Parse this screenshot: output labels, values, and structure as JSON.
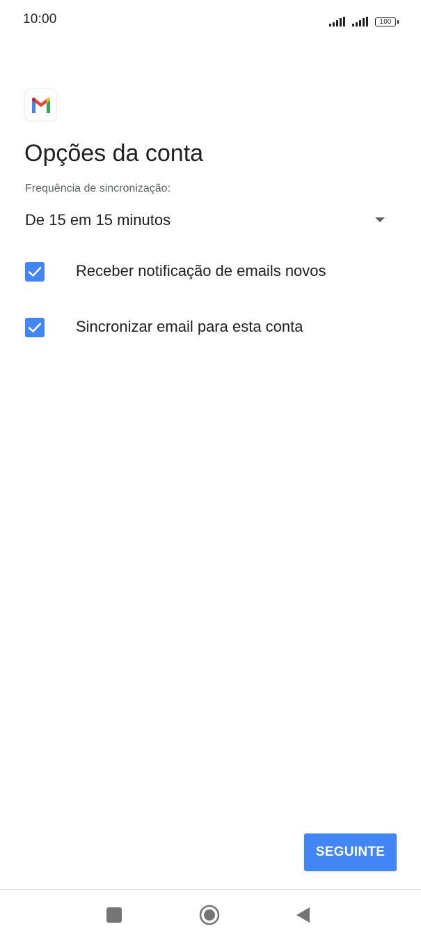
{
  "status_bar": {
    "time": "10:00",
    "battery": "100"
  },
  "page": {
    "title": "Opções da conta",
    "sync_label": "Frequência de sincronização:",
    "sync_value": "De 15 em 15 minutos",
    "options": [
      {
        "label": "Receber notificação de emails novos",
        "checked": true
      },
      {
        "label": "Sincronizar email para esta conta",
        "checked": true
      }
    ],
    "next_button": "SEGUINTE"
  },
  "colors": {
    "accent": "#4285f4",
    "text_primary": "#202124",
    "text_secondary": "#5f6368"
  },
  "icons": {
    "logo": "gmail-icon",
    "dropdown": "dropdown-arrow-icon",
    "checkbox": "checkmark-icon",
    "nav_recents": "square-icon",
    "nav_home": "circle-icon",
    "nav_back": "triangle-back-icon"
  }
}
